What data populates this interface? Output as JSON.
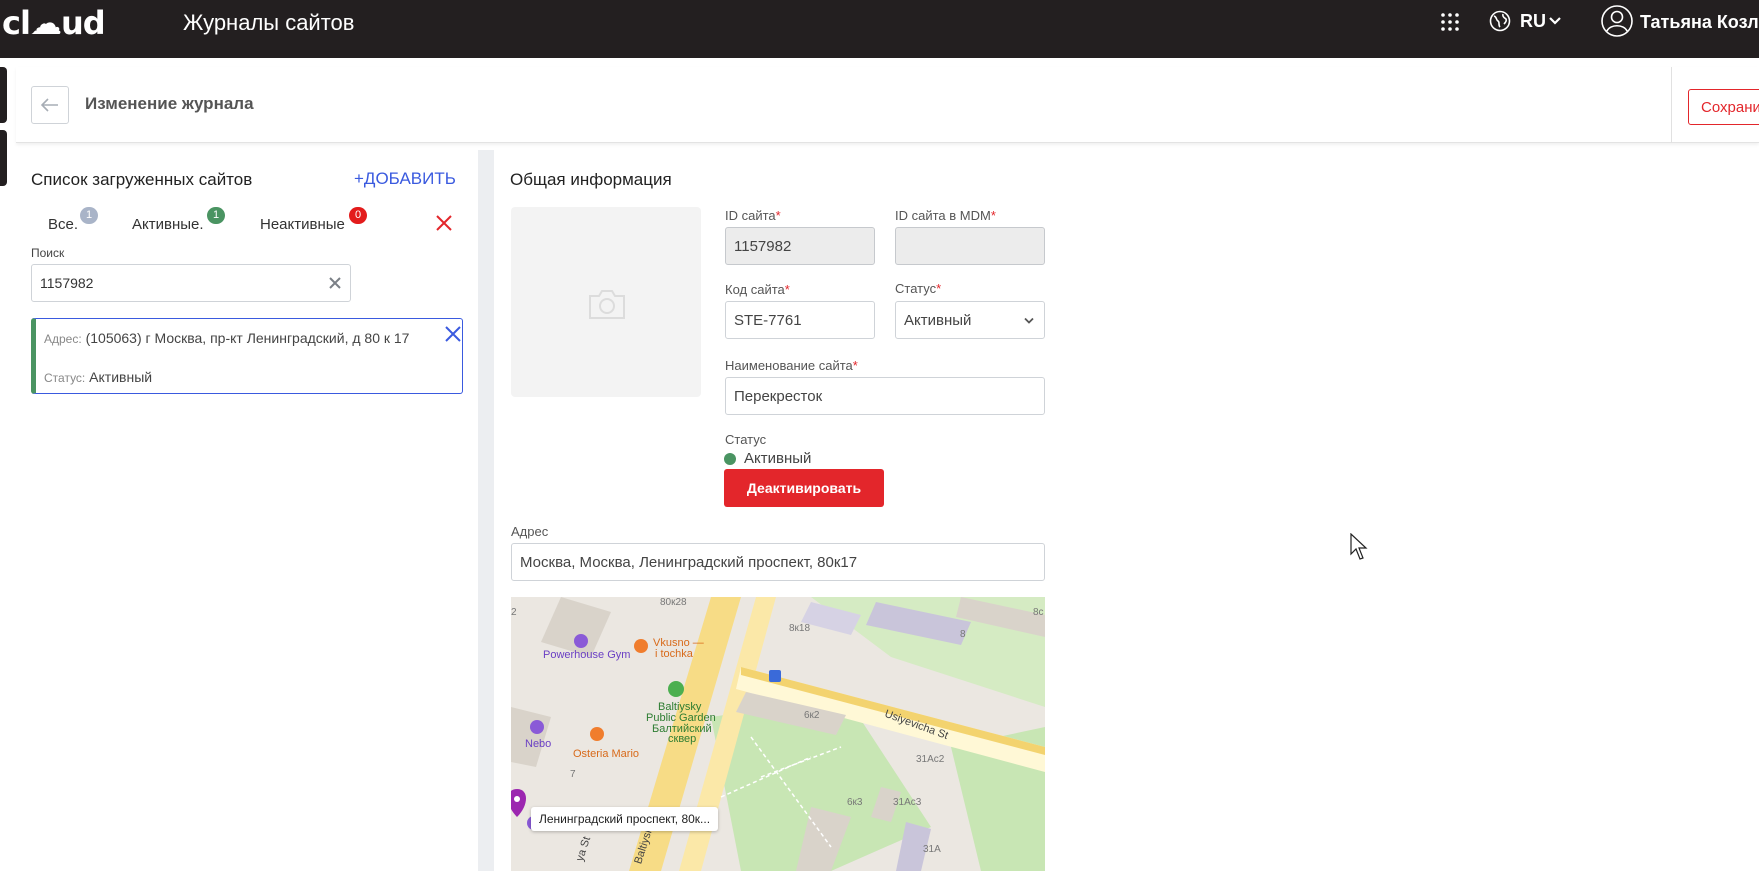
{
  "topbar": {
    "logo": "cl☁ud",
    "app_title": "Журналы сайтов",
    "apps_icon": "grid-icon",
    "lang": "RU",
    "user_name": "Татьяна Козло"
  },
  "header": {
    "title": "Изменение журнала",
    "save_label": "Сохрани"
  },
  "sidebar": {
    "title": "Список загруженных сайтов",
    "add_label": "+ДОБАВИТЬ",
    "filters": [
      {
        "label": "Все.",
        "count": "1",
        "color": "#a9b4c8"
      },
      {
        "label": "Активные.",
        "count": "1",
        "color": "#4a9462"
      },
      {
        "label": "Неактивные",
        "count": "0",
        "color": "#e31c1c"
      }
    ],
    "search_label": "Поиск",
    "search_value": "1157982",
    "card": {
      "addr_label": "Адрес:",
      "addr_value": "(105063) г Москва, пр-кт Ленинградский, д 80 к 17",
      "status_label": "Статус:",
      "status_value": "Активный"
    }
  },
  "main": {
    "title": "Общая информация",
    "fields": {
      "site_id_label": "ID сайта",
      "site_id_value": "1157982",
      "mdm_id_label": "ID сайта в MDM",
      "mdm_id_value": "",
      "code_label": "Код сайта",
      "code_value": "STE-7761",
      "status_label": "Статус",
      "status_value": "Активный",
      "name_label": "Наименование сайта",
      "name_value": "Перекресток",
      "address_label": "Адрес",
      "address_value": "Москва, Москва, Ленинградский проспект, 80к17"
    },
    "state": {
      "label": "Статус",
      "value": "Активный",
      "deactivate_label": "Деактивировать"
    },
    "map": {
      "popup": "Ленинградский проспект, 80к...",
      "labels": {
        "gym": "Powerhouse Gym",
        "cafe1": "Vkusno —",
        "cafe2": "i tochka",
        "garden1": "Baltiysky",
        "garden2": "Public Garden",
        "garden3": "Балтийский",
        "garden4": "сквер",
        "nebo": "Nebo",
        "osteria": "Osteria Mario",
        "street1": "Usiyevicha St",
        "street2": "Baltiysky",
        "b80k28": "80к28",
        "b8k18": "8к18",
        "b8": "8",
        "b6k2": "6к2",
        "b31ac2": "31Ас2",
        "b6k3": "6к3",
        "b31ac3": "31Ас3",
        "b31a": "31А",
        "b7": "7",
        "b2": "2",
        "b8c": "8с",
        "street3": "ya St"
      }
    }
  }
}
